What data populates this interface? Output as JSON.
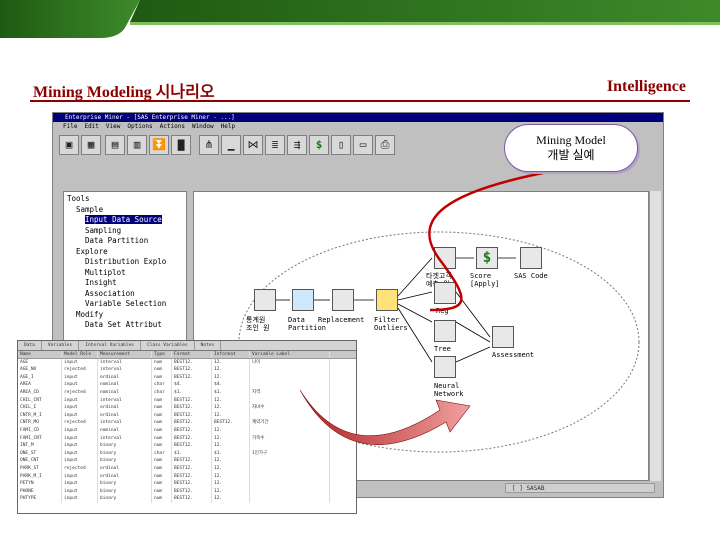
{
  "slide": {
    "title_left": "Mining Modeling  시나리오",
    "title_right": "Intelligence"
  },
  "colors": {
    "accent": "#8b0000",
    "window_title": "#00007b",
    "curve": "#c00000",
    "top_band": "#2e6e1e"
  },
  "window": {
    "title": "Enterprise Miner - [SAS Enterprise Miner - ...]",
    "menu": [
      "File",
      "Edit",
      "View",
      "Options",
      "Actions",
      "Window",
      "Help"
    ],
    "status": "[ ] SASAB"
  },
  "tree": {
    "items": [
      {
        "label": "Tools",
        "indent": 0
      },
      {
        "label": "Sample",
        "indent": 1
      },
      {
        "label": "Input Data Source",
        "indent": 2,
        "selected": true
      },
      {
        "label": "Sampling",
        "indent": 2
      },
      {
        "label": "Data Partition",
        "indent": 2
      },
      {
        "label": "Explore",
        "indent": 1
      },
      {
        "label": "Distribution Explo",
        "indent": 2
      },
      {
        "label": "Multiplot",
        "indent": 2
      },
      {
        "label": "Insight",
        "indent": 2
      },
      {
        "label": "Association",
        "indent": 2
      },
      {
        "label": "Variable Selection",
        "indent": 2
      },
      {
        "label": "Modify",
        "indent": 1
      },
      {
        "label": "Data Set Attribut",
        "indent": 2
      }
    ]
  },
  "diagram": {
    "nodes": {
      "source": "통계원\n조인 원",
      "partition": "Data\nPartition",
      "replacement": "Replacement",
      "filter": "Filter\nOutliers",
      "target": "타겟고객\n예측 원",
      "score": "Score\n[Apply]",
      "sas_code": "SAS Code",
      "reg": "Reg",
      "tree": "Tree",
      "assessment": "Assessment",
      "neural": "Neural\nNetwork"
    }
  },
  "callout": {
    "line1": "Mining Model",
    "line2": "개발 실예"
  },
  "variables": {
    "tabs": [
      "Data",
      "Variables",
      "Interval Variables",
      "Class Variables",
      "Notes"
    ],
    "columns": [
      "Name",
      "Model Role",
      "Measurement",
      "Type",
      "Format",
      "Informat",
      "Variable Label"
    ],
    "rows": [
      [
        "AGE",
        "input",
        "interval",
        "num",
        "BEST12.",
        "12.",
        "나이"
      ],
      [
        "AGE_NO",
        "rejected",
        "interval",
        "num",
        "BEST12.",
        "12.",
        ""
      ],
      [
        "AGE_I",
        "input",
        "ordinal",
        "num",
        "BEST12.",
        "12.",
        ""
      ],
      [
        "AREA",
        "input",
        "nominal",
        "char",
        "$4.",
        "$4.",
        ""
      ],
      [
        "AREA_CD",
        "rejected",
        "nominal",
        "char",
        "$1.",
        "$1.",
        "지역"
      ],
      [
        "CHIL_CNT",
        "input",
        "interval",
        "num",
        "BEST12.",
        "12.",
        ""
      ],
      [
        "CHIL_I",
        "input",
        "ordinal",
        "num",
        "BEST12.",
        "12.",
        "자녀수"
      ],
      [
        "CNTR_M_I",
        "input",
        "ordinal",
        "num",
        "BEST12.",
        "12.",
        ""
      ],
      [
        "CNTR_MO",
        "rejected",
        "interval",
        "num",
        "BEST12.",
        "BEST12.",
        "계약기간"
      ],
      [
        "FAMI_CD",
        "input",
        "nominal",
        "num",
        "BEST12.",
        "12.",
        ""
      ],
      [
        "FAMI_CNT",
        "input",
        "interval",
        "num",
        "BEST12.",
        "12.",
        "가족수"
      ],
      [
        "INT_M",
        "input",
        "binary",
        "num",
        "BEST12.",
        "12.",
        ""
      ],
      [
        "ONE_ST",
        "input",
        "binary",
        "char",
        "$1.",
        "$1.",
        "1인가구"
      ],
      [
        "ONE_CNT",
        "input",
        "binary",
        "num",
        "BEST12.",
        "12.",
        ""
      ],
      [
        "PARK_ST",
        "rejected",
        "ordinal",
        "num",
        "BEST12.",
        "12.",
        ""
      ],
      [
        "PARK_M_I",
        "input",
        "ordinal",
        "num",
        "BEST12.",
        "12.",
        ""
      ],
      [
        "PETYN",
        "input",
        "binary",
        "num",
        "BEST12.",
        "12.",
        ""
      ],
      [
        "PHONE",
        "input",
        "binary",
        "num",
        "BEST12.",
        "12.",
        ""
      ],
      [
        "PHTYPE",
        "input",
        "binary",
        "num",
        "BEST12.",
        "12.",
        ""
      ]
    ]
  }
}
